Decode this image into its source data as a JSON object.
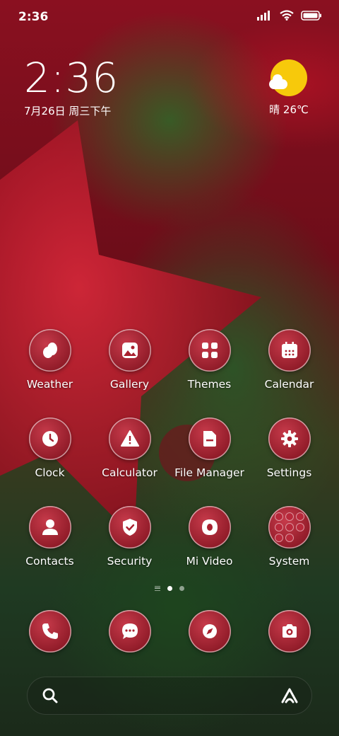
{
  "status_bar": {
    "time": "2:36",
    "icons": [
      "signal-icon",
      "wifi-icon",
      "battery-icon"
    ]
  },
  "clock_widget": {
    "time": "2:36",
    "date": "7月26日 周三下午"
  },
  "weather_widget": {
    "icon": "sunny-cloud-icon",
    "text": "晴 26℃"
  },
  "apps": [
    {
      "label": "Weather",
      "icon": "weather-icon"
    },
    {
      "label": "Gallery",
      "icon": "gallery-icon"
    },
    {
      "label": "Themes",
      "icon": "themes-icon"
    },
    {
      "label": "Calendar",
      "icon": "calendar-icon"
    },
    {
      "label": "Clock",
      "icon": "clock-icon"
    },
    {
      "label": "Calculator",
      "icon": "calculator-icon"
    },
    {
      "label": "File Manager",
      "icon": "file-manager-icon"
    },
    {
      "label": "Settings",
      "icon": "settings-icon"
    },
    {
      "label": "Contacts",
      "icon": "contacts-icon"
    },
    {
      "label": "Security",
      "icon": "security-icon"
    },
    {
      "label": "Mi Video",
      "icon": "mi-video-icon"
    },
    {
      "label": "System",
      "icon": "folder-icon"
    }
  ],
  "page_indicator": {
    "pages": 2,
    "active": 1
  },
  "dock": [
    {
      "icon": "phone-icon"
    },
    {
      "icon": "messages-icon"
    },
    {
      "icon": "browser-icon"
    },
    {
      "icon": "camera-icon"
    }
  ],
  "search_bar": {
    "left_icon": "search-icon",
    "right_icon": "assistant-icon"
  },
  "colors": {
    "icon_fill": "#a8202f",
    "weather_sun": "#f7c90b",
    "text": "#ffffff"
  }
}
